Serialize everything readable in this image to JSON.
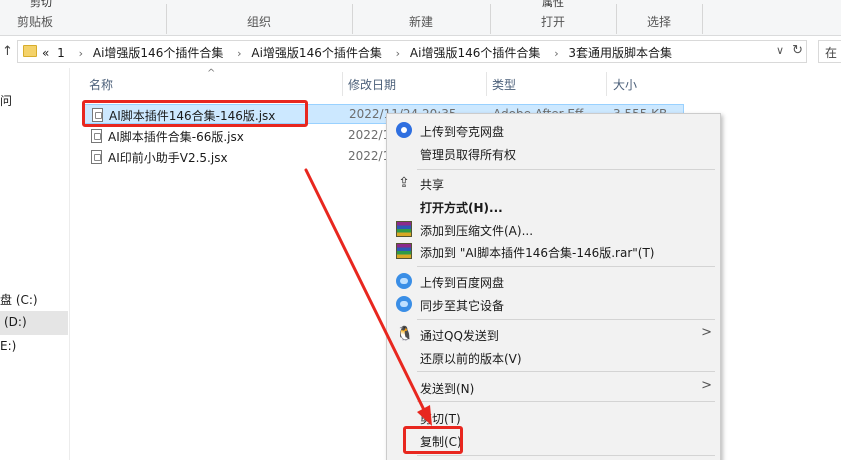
{
  "ribbon": {
    "clipboard_top": "剪切",
    "clipboard_label": "剪贴板",
    "organize_label": "组织",
    "new_label": "新建",
    "open_top": "属性",
    "open_label": "打开",
    "select_label": "选择"
  },
  "address": {
    "up_glyph": "↑",
    "chevron": "«",
    "crumbs": [
      "1",
      "Ai增强版146个插件合集",
      "Ai增强版146个插件合集",
      "Ai增强版146个插件合集",
      "3套通用版脚本合集"
    ],
    "sep_glyph": "›",
    "dropdown_glyph": "∨",
    "refresh_glyph": "↻",
    "search_stub": "在"
  },
  "nav": {
    "items": [
      {
        "label": "问"
      },
      {
        "label": "盘 (C:)"
      },
      {
        "label": "(D:)"
      },
      {
        "label": "E:)"
      }
    ]
  },
  "columns": {
    "sort_glyph": "^",
    "name": "名称",
    "date": "修改日期",
    "type": "类型",
    "size": "大小"
  },
  "files": [
    {
      "name": "AI脚本插件146合集-146版.jsx",
      "date": "2022/11/24 20:35",
      "type": "Adobe After Eff...",
      "size": "3,555 KB"
    },
    {
      "name": "AI脚本插件合集-66版.jsx",
      "date": "2022/1",
      "type": "",
      "size": ""
    },
    {
      "name": "AI印前小助手V2.5.jsx",
      "date": "2022/1",
      "type": "",
      "size": ""
    }
  ],
  "menu": {
    "upload_quark": "上传到夸克网盘",
    "take_ownership": "管理员取得所有权",
    "share": "共享",
    "open_with": "打开方式(H)...",
    "add_archive": "添加到压缩文件(A)...",
    "add_rar": "添加到 \"AI脚本插件146合集-146版.rar\"(T)",
    "upload_baidu": "上传到百度网盘",
    "sync_devices": "同步至其它设备",
    "send_qq": "通过QQ发送到",
    "restore_versions": "还原以前的版本(V)",
    "send_to": "发送到(N)",
    "cut": "剪切(T)",
    "copy": "复制(C)",
    "submenu_glyph": ">",
    "share_glyph": "⇪",
    "qq_glyph": "🐧"
  },
  "colors": {
    "highlight_red": "#e8271f",
    "selection_blue": "#cce8ff"
  }
}
